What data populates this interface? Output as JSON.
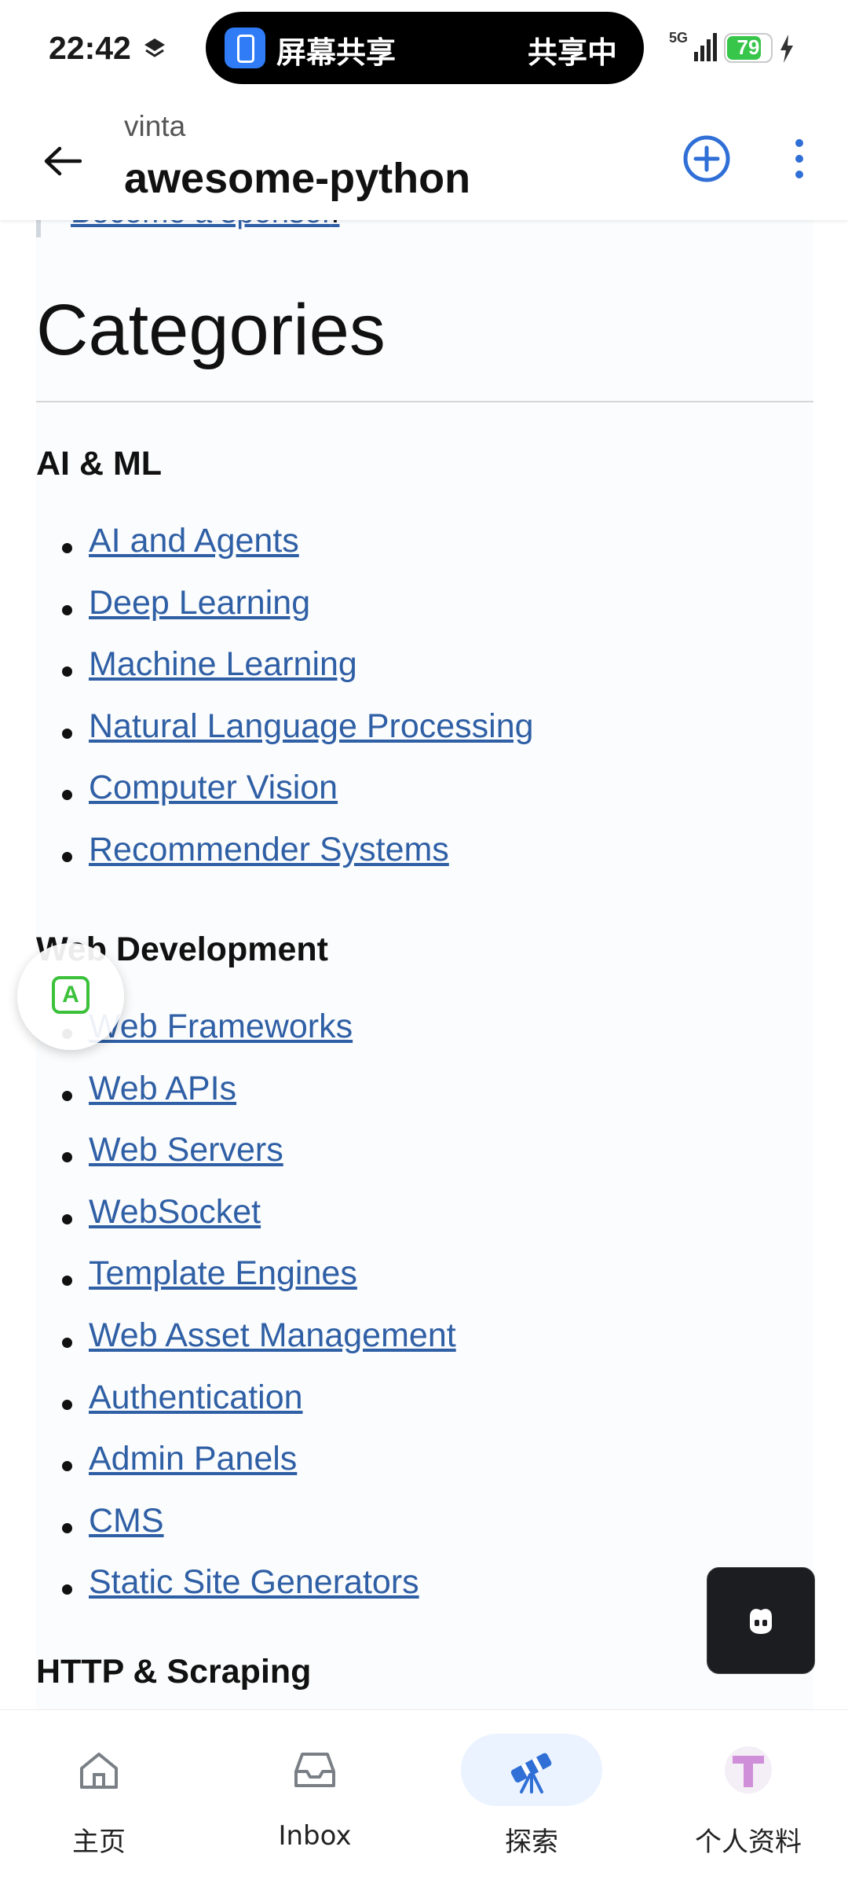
{
  "status_bar": {
    "time": "22:42",
    "share_title": "屏幕共享",
    "share_status": "共享中",
    "network": "5G",
    "battery": "79",
    "battery_level": 0.79,
    "icons": [
      "layers-icon",
      "screen-share-icon",
      "signal-icon",
      "battery-icon",
      "charging-bolt-icon"
    ]
  },
  "header": {
    "owner": "vinta",
    "repo": "awesome-python",
    "icons": [
      "back-arrow-icon",
      "add-circle-icon",
      "more-vertical-icon"
    ]
  },
  "content": {
    "sponsor_link": "Become a sponsor",
    "sponsor_period": ".",
    "heading": "Categories",
    "sections": [
      {
        "title": "AI & ML",
        "links": [
          "AI and Agents",
          "Deep Learning",
          "Machine Learning",
          "Natural Language Processing",
          "Computer Vision",
          "Recommender Systems"
        ]
      },
      {
        "title": "Web Development",
        "links": [
          "Web Frameworks",
          "Web APIs",
          "Web Servers",
          "WebSocket",
          "Template Engines",
          "Web Asset Management",
          "Authentication",
          "Admin Panels",
          "CMS",
          "Static Site Generators"
        ]
      },
      {
        "title": "HTTP & Scraping",
        "links": []
      }
    ]
  },
  "floating": {
    "translate_icon_letter": "A",
    "translate_color": "#3cc13b",
    "copilot_icon": "copilot-icon"
  },
  "bottom_nav": {
    "items": [
      {
        "label": "主页",
        "icon": "home-icon",
        "active": false
      },
      {
        "label": "Inbox",
        "icon": "inbox-icon",
        "active": false
      },
      {
        "label": "探索",
        "icon": "telescope-icon",
        "active": true
      },
      {
        "label": "个人资料",
        "icon": "profile-icon",
        "active": false
      }
    ]
  },
  "colors": {
    "link": "#2f5fa5",
    "accent": "#2f6fd6",
    "active_nav_bg": "#eaf3ff"
  }
}
